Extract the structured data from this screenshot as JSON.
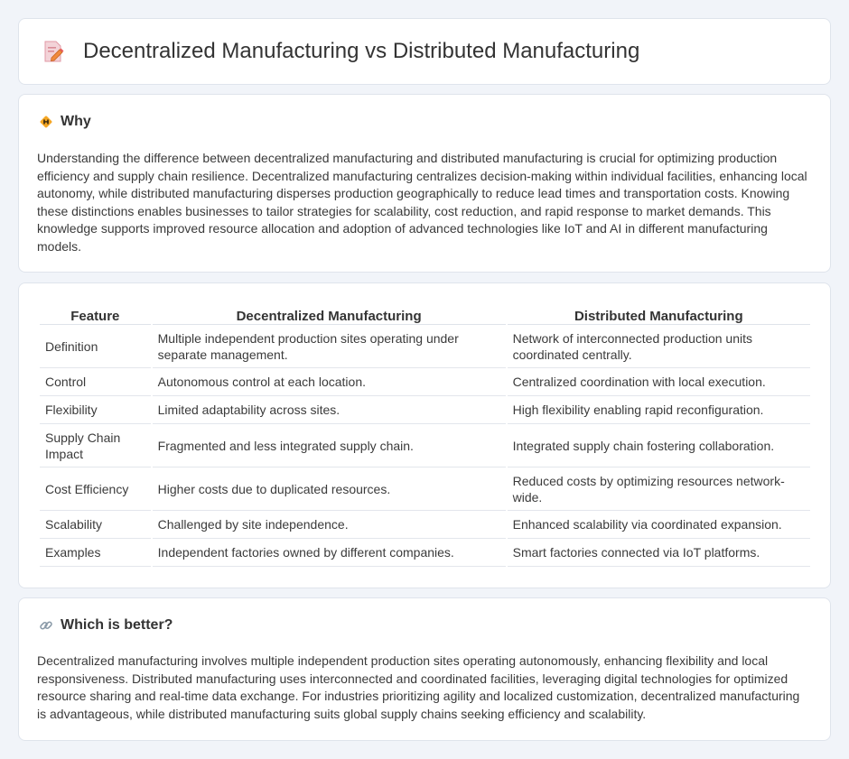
{
  "header": {
    "title": "Decentralized Manufacturing vs Distributed Manufacturing",
    "icon": "pencil-document-icon"
  },
  "why": {
    "icon": "diamond-sign-icon",
    "heading": "Why",
    "text": "Understanding the difference between decentralized manufacturing and distributed manufacturing is crucial for optimizing production efficiency and supply chain resilience. Decentralized manufacturing centralizes decision-making within individual facilities, enhancing local autonomy, while distributed manufacturing disperses production geographically to reduce lead times and transportation costs. Knowing these distinctions enables businesses to tailor strategies for scalability, cost reduction, and rapid response to market demands. This knowledge supports improved resource allocation and adoption of advanced technologies like IoT and AI in different manufacturing models."
  },
  "table": {
    "headers": [
      "Feature",
      "Decentralized Manufacturing",
      "Distributed Manufacturing"
    ],
    "rows": [
      [
        "Definition",
        "Multiple independent production sites operating under separate management.",
        "Network of interconnected production units coordinated centrally."
      ],
      [
        "Control",
        "Autonomous control at each location.",
        "Centralized coordination with local execution."
      ],
      [
        "Flexibility",
        "Limited adaptability across sites.",
        "High flexibility enabling rapid reconfiguration."
      ],
      [
        "Supply Chain Impact",
        "Fragmented and less integrated supply chain.",
        "Integrated supply chain fostering collaboration."
      ],
      [
        "Cost Efficiency",
        "Higher costs due to duplicated resources.",
        "Reduced costs by optimizing resources network-wide."
      ],
      [
        "Scalability",
        "Challenged by site independence.",
        "Enhanced scalability via coordinated expansion."
      ],
      [
        "Examples",
        "Independent factories owned by different companies.",
        "Smart factories connected via IoT platforms."
      ]
    ]
  },
  "better": {
    "icon": "link-icon",
    "heading": "Which is better?",
    "text": "Decentralized manufacturing involves multiple independent production sites operating autonomously, enhancing flexibility and local responsiveness. Distributed manufacturing uses interconnected and coordinated facilities, leveraging digital technologies for optimized resource sharing and real-time data exchange. For industries prioritizing agility and localized customization, decentralized manufacturing is advantageous, while distributed manufacturing suits global supply chains seeking efficiency and scalability."
  }
}
